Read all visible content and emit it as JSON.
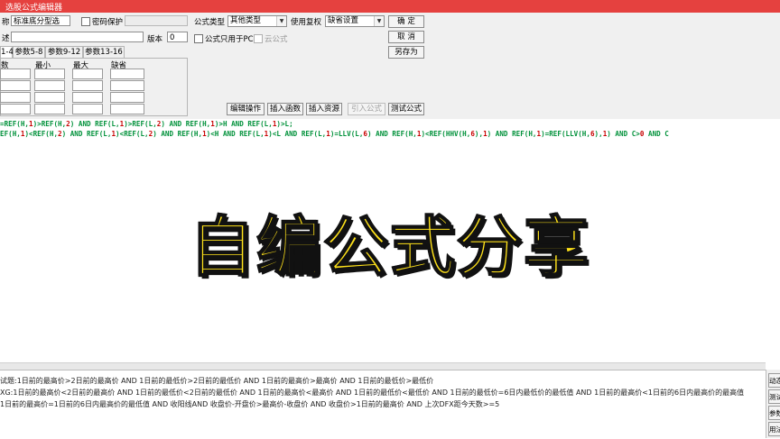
{
  "window": {
    "title": "选股公式编辑器"
  },
  "form": {
    "name_label": "称",
    "name_value": "标准底分型选",
    "password_label": "密码保护",
    "desc_label": "述",
    "version_label": "版本",
    "version_value": "0",
    "pc_only_label": "公式只用于PC",
    "cloud_label": "云公式",
    "formula_type_label": "公式类型",
    "formula_type_value": "其他类型",
    "reweight_label": "使用复权",
    "reweight_value": "缺省设置"
  },
  "buttons": {
    "ok": "确  定",
    "cancel": "取  消",
    "save_as": "另存为",
    "edit_op": "编辑操作",
    "insert_func": "插入函数",
    "insert_res": "插入资源",
    "import_formula": "引入公式",
    "test_formula": "测试公式"
  },
  "tabs": [
    "1-4",
    "参数5-8",
    "参数9-12",
    "参数13-16"
  ],
  "param_headers": [
    "数",
    "最小",
    "最大",
    "缺省"
  ],
  "code_lines": [
    [
      [
        "g",
        "=REF(H,"
      ],
      [
        "r",
        "1"
      ],
      [
        "g",
        ")>REF(H,"
      ],
      [
        "r",
        "2"
      ],
      [
        "g",
        ") AND REF(L,"
      ],
      [
        "r",
        "1"
      ],
      [
        "g",
        ")>REF(L,"
      ],
      [
        "r",
        "2"
      ],
      [
        "g",
        ") AND REF(H,"
      ],
      [
        "r",
        "1"
      ],
      [
        "g",
        ")>H AND REF(L,"
      ],
      [
        "r",
        "1"
      ],
      [
        "g",
        ")>L;"
      ]
    ],
    [
      [
        "g",
        "EF(H,"
      ],
      [
        "r",
        "1"
      ],
      [
        "g",
        ")<REF(H,"
      ],
      [
        "r",
        "2"
      ],
      [
        "g",
        ") AND REF(L,"
      ],
      [
        "r",
        "1"
      ],
      [
        "g",
        ")<REF(L,"
      ],
      [
        "r",
        "2"
      ],
      [
        "g",
        ") AND REF(H,"
      ],
      [
        "r",
        "1"
      ],
      [
        "g",
        ")<H AND REF(L,"
      ],
      [
        "r",
        "1"
      ],
      [
        "g",
        ")<L AND REF(L,"
      ],
      [
        "r",
        "1"
      ],
      [
        "g",
        ")=LLV(L,"
      ],
      [
        "r",
        "6"
      ],
      [
        "g",
        ") AND REF(H,"
      ],
      [
        "r",
        "1"
      ],
      [
        "g",
        ")<REF(HHV(H,"
      ],
      [
        "r",
        "6"
      ],
      [
        "g",
        "),"
      ],
      [
        "r",
        "1"
      ],
      [
        "g",
        ") AND REF(H,"
      ],
      [
        "r",
        "1"
      ],
      [
        "g",
        ")=REF(LLV(H,"
      ],
      [
        "r",
        "6"
      ],
      [
        "g",
        "),"
      ],
      [
        "r",
        "1"
      ],
      [
        "g",
        ") AND C>"
      ],
      [
        "r",
        "0"
      ],
      [
        "g",
        " AND C"
      ]
    ]
  ],
  "banner": "自编公式分享",
  "bottom_lines": [
    "试题:1日前的最高价>2日前的最高价 AND 1日前的最低价>2日前的最低价 AND 1日前的最高价>最高价 AND 1日前的最低价>最低价",
    "XG:1日前的最高价<2日前的最高价 AND 1日前的最低价<2日前的最低价 AND 1日前的最高价<最高价 AND 1日前的最低价<最低价 AND 1日前的最低价=6日内最低价的最低值 AND 1日前的最高价<1日前的6日内最高价的最高值",
    "1日前的最高价=1日前的6日内最高价的最低值 AND 收阳线AND 收盘价-开盘价>最高价-收盘价 AND 收盘价>1日前的最高价 AND 上次DFX距今天数>=5"
  ],
  "side_buttons": [
    "动态",
    "测试",
    "参数",
    "用法"
  ]
}
